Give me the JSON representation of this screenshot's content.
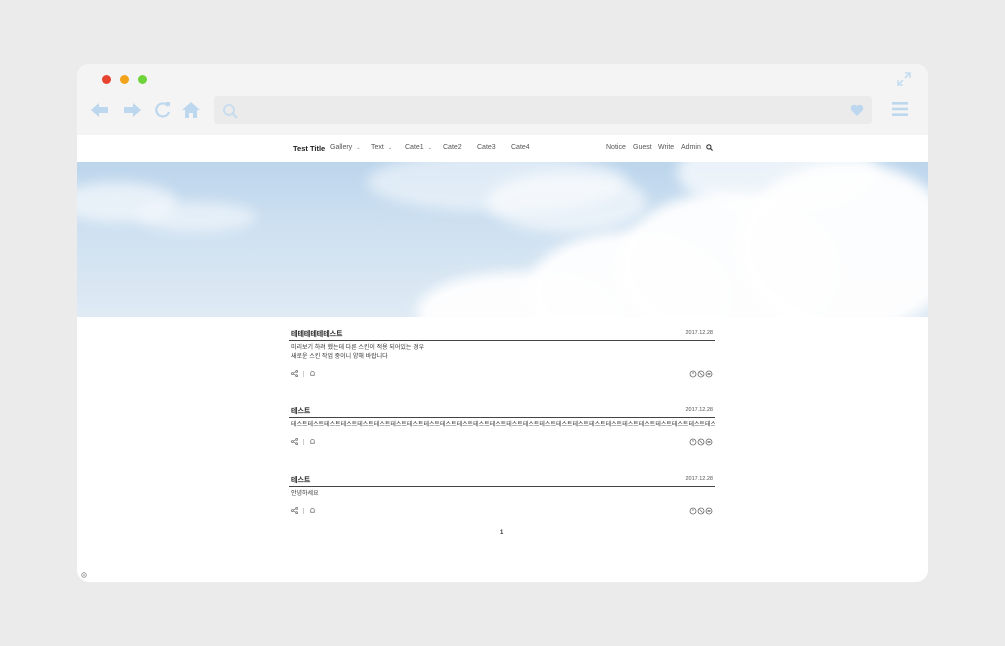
{
  "browser": {
    "traffic_lights": [
      "close",
      "minimize",
      "maximize"
    ],
    "icons": [
      "back-arrow-icon",
      "forward-arrow-icon",
      "reload-icon",
      "home-icon",
      "search-icon",
      "heart-icon",
      "hamburger-menu-icon",
      "expand-icon"
    ],
    "accent": "#bdd7ee"
  },
  "site": {
    "title": "Test Title",
    "nav_left": [
      {
        "label": "Gallery",
        "dropdown": true
      },
      {
        "label": "Text",
        "dropdown": true
      },
      {
        "label": "Cate1",
        "dropdown": true
      },
      {
        "label": "Cate2",
        "dropdown": false
      },
      {
        "label": "Cate3",
        "dropdown": false
      },
      {
        "label": "Cate4",
        "dropdown": false
      }
    ],
    "nav_right": [
      "Notice",
      "Guest",
      "Write",
      "Admin"
    ]
  },
  "posts": [
    {
      "title": "테테테테테테스트",
      "date": "2017.12.28",
      "lines": [
        "미리보기 하려 했는데 다른 스킨이 적용 되어있는 경우",
        "새로운 스킨 작업 중이니 양해 바랍니다"
      ]
    },
    {
      "title": "테스트",
      "date": "2017.12.28",
      "lines": [
        "테스트테스트테스트테스트테스트테스트테스트테스트테스트테스트테스트테스트테스트테스트테스트테스트테스트테스트테스트테스트테스트테스트테스트테스트테스트테스트테스트테스트"
      ]
    },
    {
      "title": "테스트",
      "date": "2017.12.28",
      "lines": [
        "안녕하세요"
      ]
    }
  ],
  "pagination": {
    "current": "1"
  }
}
